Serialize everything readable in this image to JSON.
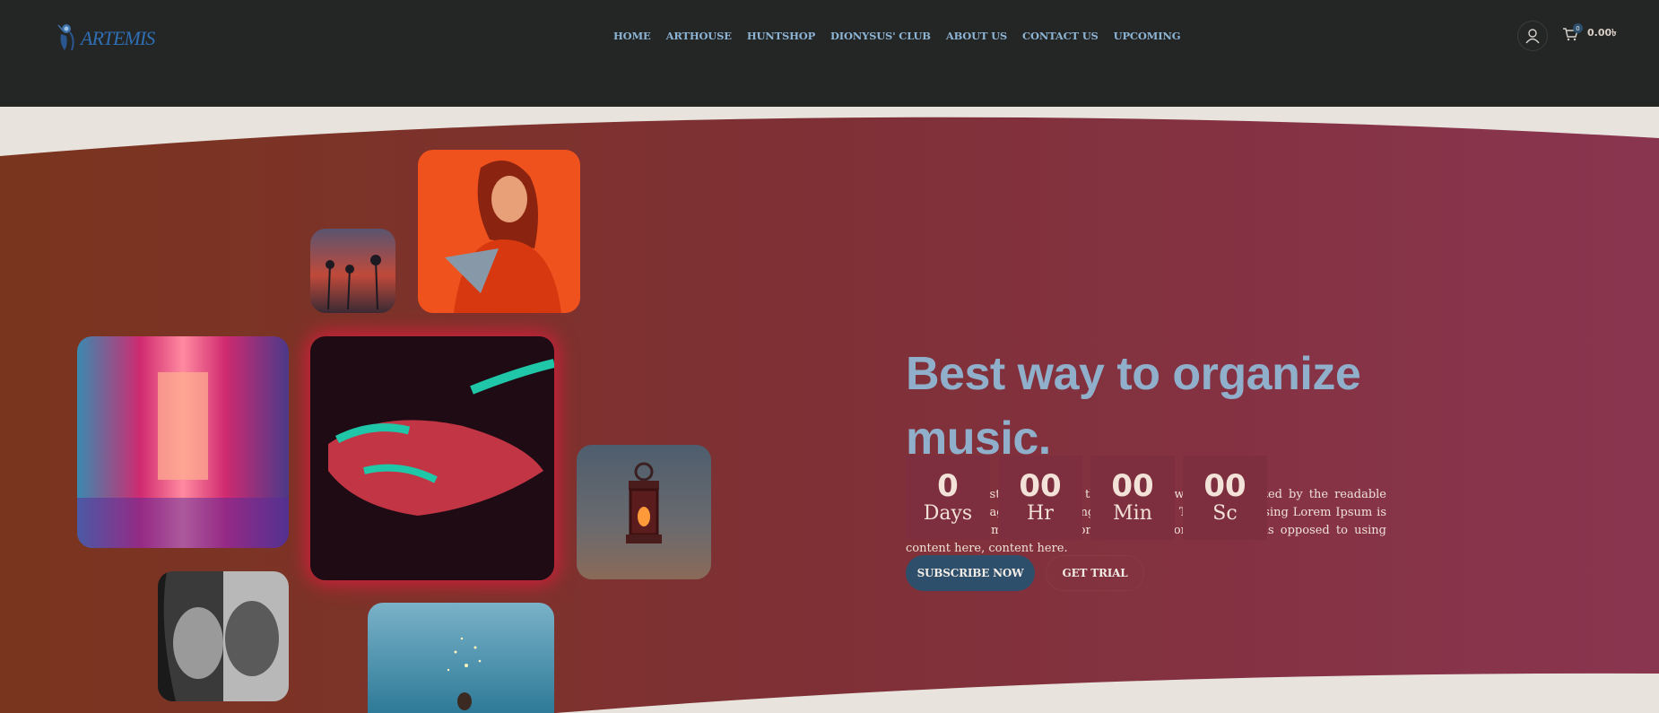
{
  "brand": {
    "logo_text": "ARTEMIS"
  },
  "nav": {
    "items": [
      "HOME",
      "ARTHOUSE",
      "HUNTSHOP",
      "DIONYSUS' CLUB",
      "ABOUT US",
      "CONTACT US",
      "UPCOMING"
    ]
  },
  "header_actions": {
    "account_icon": "user-icon",
    "cart_icon": "cart-icon",
    "cart_count": "0",
    "cart_total": "0.00৳"
  },
  "hero": {
    "headline": "Best way to organize music.",
    "paragraph": "It is a long established fact that a reader will be distracted by the readable content of a page when looking at its layout. The point of using Lorem Ipsum is that it has a more-or-less normal distribution of letters, as opposed to using content here, content here.",
    "countdown": [
      {
        "value": "0",
        "label": "Days"
      },
      {
        "value": "00",
        "label": "Hr"
      },
      {
        "value": "00",
        "label": "Min"
      },
      {
        "value": "00",
        "label": "Sc"
      }
    ],
    "buttons": {
      "subscribe": "SUBSCRIBE NOW",
      "trial": "GET TRIAL"
    }
  },
  "colors": {
    "header_bg": "#242626",
    "accent_blue": "#8fafcb",
    "button_blue": "#2e4f6b",
    "gradient_left": "#7a351e",
    "gradient_right": "#8a3550"
  }
}
